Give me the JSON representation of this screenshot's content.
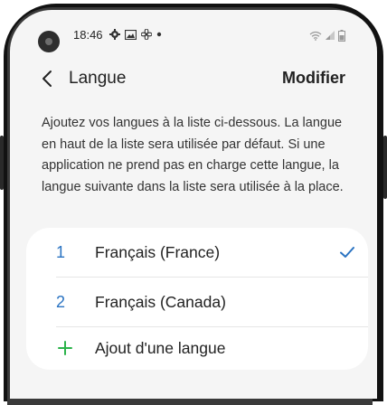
{
  "status": {
    "time": "18:46"
  },
  "header": {
    "title": "Langue",
    "edit_label": "Modifier"
  },
  "description": "Ajoutez vos langues à la liste ci-dessous. La langue en haut de la liste sera utilisée par défaut. Si une application ne prend pas en charge cette langue, la langue suivante dans la liste sera utilisée à la place.",
  "languages": [
    {
      "index": "1",
      "name": "Français (France)",
      "selected": true
    },
    {
      "index": "2",
      "name": "Français (Canada)",
      "selected": false
    }
  ],
  "add_language_label": "Ajout d'une langue",
  "colors": {
    "accent_blue": "#2a73c2",
    "add_green": "#2bb34a",
    "screen_bg": "#f5f5f5",
    "card_bg": "#ffffff"
  },
  "icons": [
    "back-arrow-icon",
    "gear-icon",
    "image-icon",
    "fan-icon",
    "dot-icon",
    "wifi-icon",
    "signal-icon",
    "battery-icon",
    "checkmark-icon",
    "plus-icon"
  ]
}
